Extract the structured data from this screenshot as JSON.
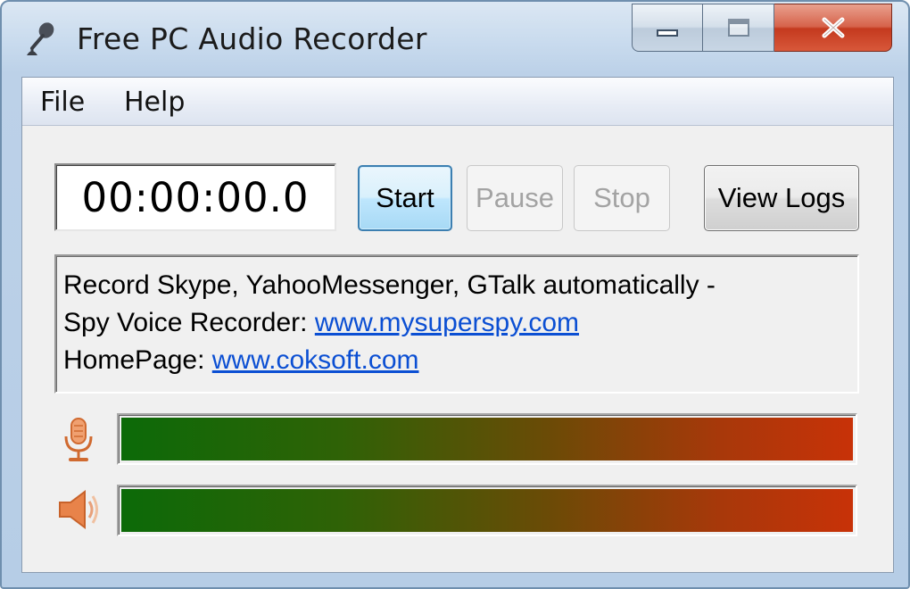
{
  "window": {
    "title": "Free PC Audio Recorder",
    "icon": "microphone-icon",
    "controls": {
      "minimize": "minimize-icon",
      "maximize": "maximize-icon",
      "close": "✕"
    }
  },
  "menu": {
    "items": [
      {
        "label": "File"
      },
      {
        "label": "Help"
      }
    ]
  },
  "recorder": {
    "timer": "00:00:00.0",
    "buttons": {
      "start": "Start",
      "pause": "Pause",
      "stop": "Stop",
      "view_logs": "View Logs"
    },
    "button_states": {
      "start": "enabled",
      "pause": "disabled",
      "stop": "disabled",
      "view_logs": "enabled"
    }
  },
  "info": {
    "line1": "Record Skype, YahooMessenger, GTalk automatically -",
    "line2_prefix": "Spy Voice Recorder: ",
    "line2_link": "www.mysuperspy.com",
    "line3_prefix": "HomePage: ",
    "line3_link": "www.coksoft.com"
  },
  "meters": {
    "microphone": {
      "icon": "microphone-icon",
      "level": 1.0
    },
    "speaker": {
      "icon": "speaker-icon",
      "level": 1.0
    }
  },
  "colors": {
    "meter_start": "#0c6a08",
    "meter_end": "#c83208",
    "link": "#0b4fd3",
    "icon_accent": "#e07a40"
  }
}
